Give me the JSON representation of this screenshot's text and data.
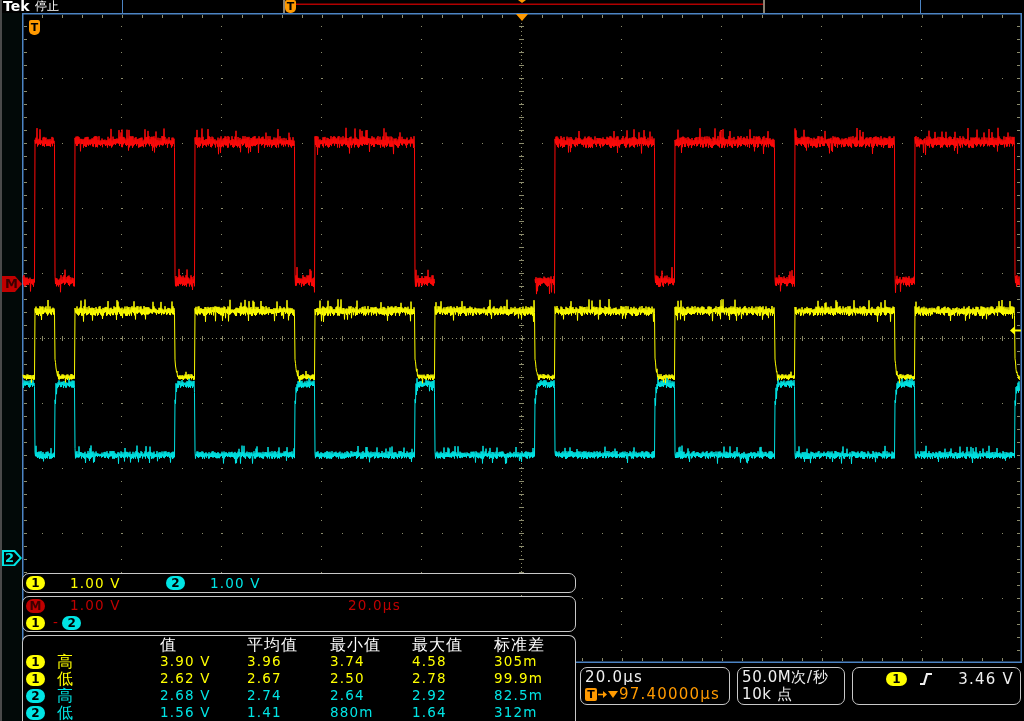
{
  "status_bar": {
    "brand": "Tek",
    "run_state": "停止",
    "record_view": {
      "trigger_marker": "T"
    }
  },
  "waveform_display": {
    "trigger_marker": "T",
    "reference_markers": [
      {
        "kind": "math",
        "label": "M",
        "color": "#c00000"
      },
      {
        "kind": "channel",
        "label": "2",
        "color": "#00e5e5"
      }
    ]
  },
  "channel_scales": [
    {
      "label": "1",
      "scale": "1.00 V",
      "color": "#ffff00"
    },
    {
      "label": "2",
      "scale": "1.00 V",
      "color": "#00e5e5"
    }
  ],
  "math": {
    "label": "M",
    "color": "#c00000",
    "scale": "1.00 V",
    "time_scale": "20.0µs",
    "expression": [
      {
        "kind": "source",
        "label": "1",
        "color": "#ffff00"
      },
      {
        "kind": "operator",
        "label": "-"
      },
      {
        "kind": "source",
        "label": "2",
        "color": "#00e5e5"
      }
    ]
  },
  "measurements": {
    "columns": [
      "值",
      "平均值",
      "最小值",
      "最大值",
      "标准差"
    ],
    "rows": [
      {
        "source": "1",
        "color": "#ffff00",
        "type": "高",
        "values": [
          "3.90 V",
          "3.96",
          "3.74",
          "4.58",
          "305m"
        ]
      },
      {
        "source": "1",
        "color": "#ffff00",
        "type": "低",
        "values": [
          "2.62 V",
          "2.67",
          "2.50",
          "2.78",
          "99.9m"
        ]
      },
      {
        "source": "2",
        "color": "#00e5e5",
        "type": "高",
        "values": [
          "2.68 V",
          "2.74",
          "2.64",
          "2.92",
          "82.5m"
        ]
      },
      {
        "source": "2",
        "color": "#00e5e5",
        "type": "低",
        "values": [
          "1.56 V",
          "1.41",
          "880m",
          "1.64",
          "312m"
        ]
      }
    ]
  },
  "horizontal": {
    "scale": "20.0µs",
    "trigger_marker": "T",
    "delay": "97.40000µs"
  },
  "acquisition": {
    "sample_rate": "50.0M次/秒",
    "record_length": "10k 点"
  },
  "trigger": {
    "source": "1",
    "color": "#ffff00",
    "rising_slope": true,
    "level": "3.46 V"
  }
}
